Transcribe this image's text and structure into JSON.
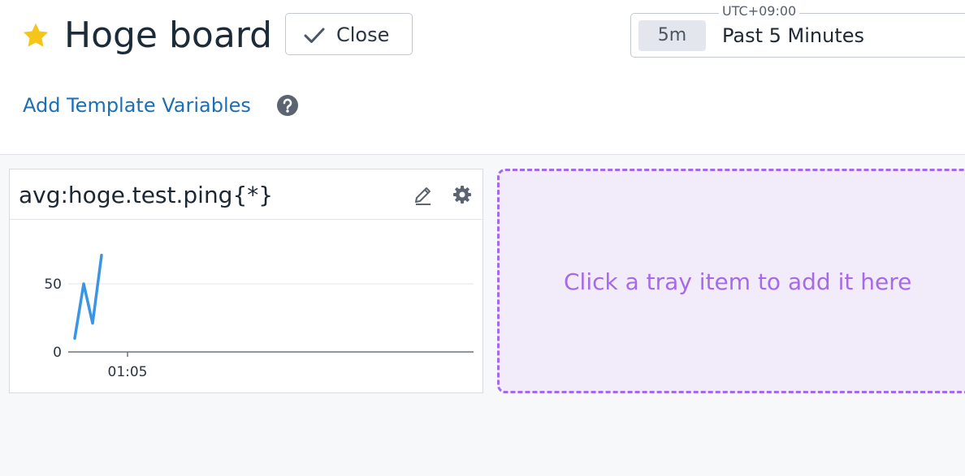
{
  "header": {
    "title": "Hoge board",
    "close_label": "Close",
    "favorite_icon": "star-icon",
    "favorite_color": "#f5c518"
  },
  "time_selector": {
    "timezone": "UTC+09:00",
    "short_label": "5m",
    "range_label": "Past 5 Minutes"
  },
  "template_vars": {
    "add_label": "Add Template Variables",
    "help_icon": "question-circle-icon"
  },
  "widget": {
    "title": "avg:hoge.test.ping{*}",
    "edit_icon": "pencil-icon",
    "settings_icon": "gear-icon",
    "series_color": "#3b95e6"
  },
  "chart_data": {
    "type": "line",
    "y_ticks": [
      "0",
      "50"
    ],
    "x_ticks": [
      "01:05"
    ],
    "ylim": [
      0,
      120
    ],
    "grid": "horizontal",
    "series": [
      {
        "values": [
          10,
          50,
          21,
          71
        ]
      }
    ]
  },
  "tray": {
    "message": "Click a tray item to add it here",
    "accent": "#a56ae8"
  }
}
